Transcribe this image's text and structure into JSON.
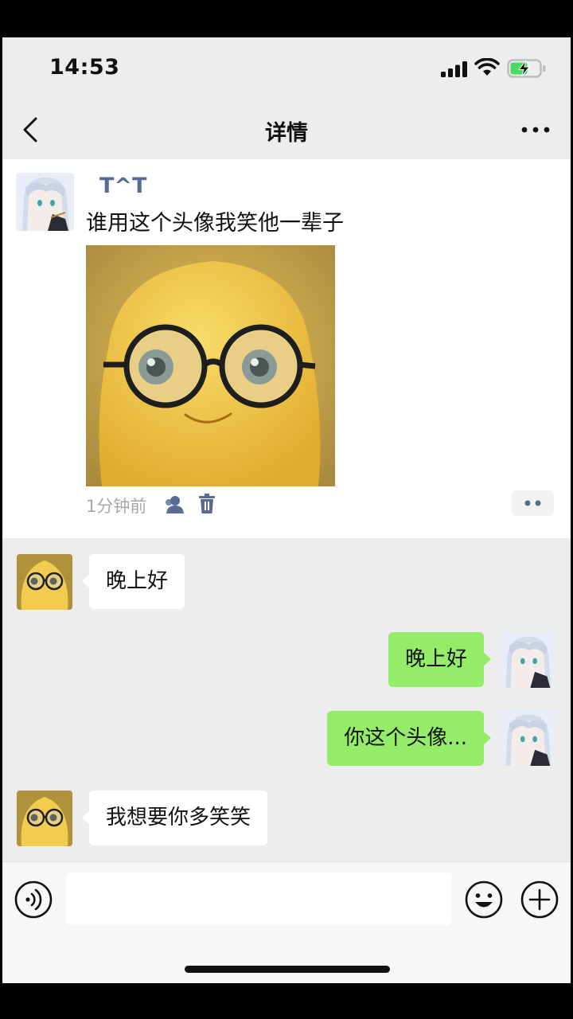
{
  "status_bar": {
    "time": "14:53"
  },
  "nav": {
    "title": "详情"
  },
  "post": {
    "author": "T^T",
    "text": "谁用这个头像我笑他一辈子",
    "time_ago": "1分钟前"
  },
  "messages": [
    {
      "side": "in",
      "text": "晚上好"
    },
    {
      "side": "out",
      "text": "晚上好"
    },
    {
      "side": "out",
      "text": "你这个头像..."
    },
    {
      "side": "in",
      "text": "我想要你多笑笑"
    }
  ],
  "input": {
    "placeholder": ""
  },
  "colors": {
    "name_link": "#576b95",
    "bubble_out": "#95ec69",
    "bubble_in": "#ffffff",
    "background": "#ededed"
  }
}
